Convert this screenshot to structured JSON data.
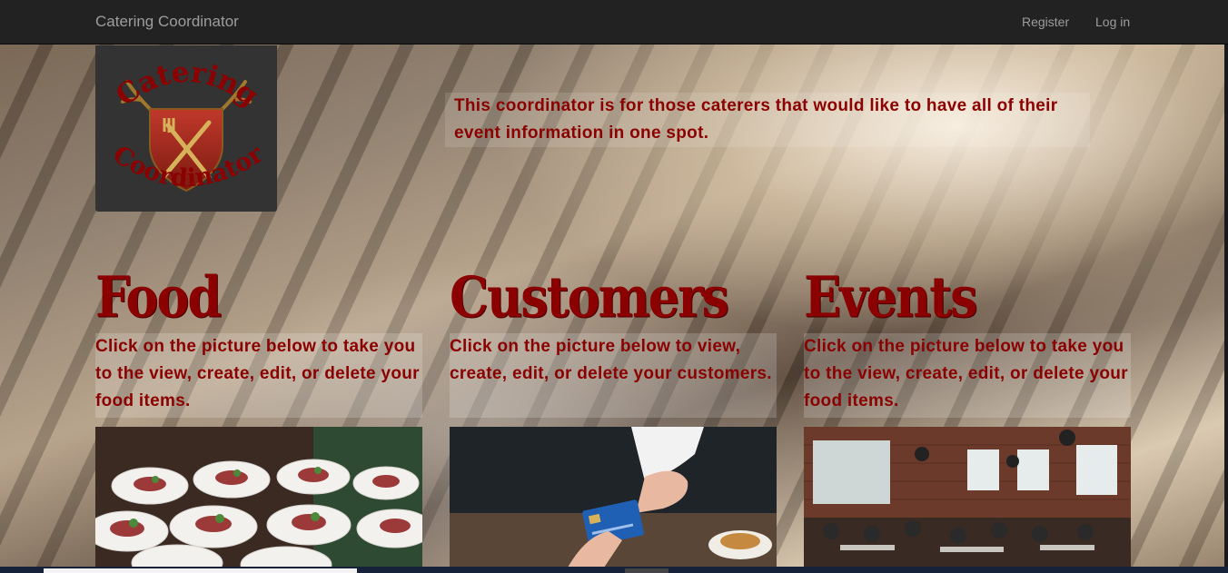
{
  "navbar": {
    "brand": "Catering Coordinator",
    "links": [
      {
        "label": "Register"
      },
      {
        "label": "Log in"
      }
    ]
  },
  "logo": {
    "line1": "Catering",
    "line2": "Coordinator"
  },
  "intro": {
    "text": "This coordinator is for those caterers that would like to have all of their event information in one spot."
  },
  "sections": [
    {
      "title": "Food",
      "description": "Click on the picture below to take you to the view, create, edit, or delete your food items."
    },
    {
      "title": "Customers",
      "description": "Click on the picture below to view, create, edit, or delete your customers."
    },
    {
      "title": "Events",
      "description": "Click on the picture below to take you to the view, create, edit, or delete your food items."
    }
  ],
  "colors": {
    "navbar": "#222222",
    "accent": "#8b0000",
    "nav_text": "#9d9d9d",
    "logo_bg": "#333333"
  }
}
